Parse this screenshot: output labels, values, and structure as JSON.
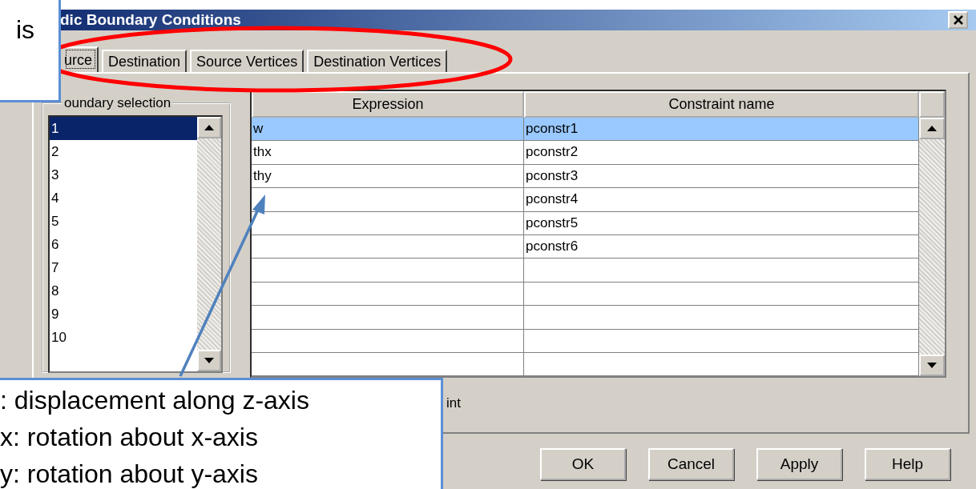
{
  "window": {
    "title": "dic Boundary Conditions"
  },
  "tabs": [
    {
      "label": "urce",
      "selected": true
    },
    {
      "label": "Destination",
      "selected": false
    },
    {
      "label": "Source Vertices",
      "selected": false
    },
    {
      "label": "Destination Vertices",
      "selected": false
    }
  ],
  "boundary_selection": {
    "label": "oundary selection",
    "items": [
      {
        "label": "1",
        "selected": true
      },
      {
        "label": "2",
        "selected": false
      },
      {
        "label": "3",
        "selected": false
      },
      {
        "label": "4",
        "selected": false
      },
      {
        "label": "5",
        "selected": false
      },
      {
        "label": "6",
        "selected": false
      },
      {
        "label": "7",
        "selected": false
      },
      {
        "label": "8",
        "selected": false
      },
      {
        "label": "9",
        "selected": false
      },
      {
        "label": "10",
        "selected": false
      }
    ]
  },
  "table": {
    "columns": [
      "Expression",
      "Constraint name"
    ],
    "rows": [
      {
        "expression": "w",
        "constraint_name": "pconstr1",
        "selected": true
      },
      {
        "expression": "thx",
        "constraint_name": "pconstr2",
        "selected": false
      },
      {
        "expression": "thy",
        "constraint_name": "pconstr3",
        "selected": false
      },
      {
        "constraint_name": "pconstr4",
        "selected": false
      },
      {
        "constraint_name": "pconstr5",
        "selected": false
      },
      {
        "constraint_name": "pconstr6",
        "selected": false
      },
      {
        "selected": false
      },
      {
        "selected": false
      },
      {
        "selected": false
      },
      {
        "selected": false
      },
      {
        "selected": false
      }
    ]
  },
  "checkbox_label": "int",
  "buttons": [
    "OK",
    "Cancel",
    "Apply",
    "Help"
  ],
  "callouts": [
    {
      "lines": [
        "is"
      ]
    },
    {
      "lines": [
        ": displacement along z-axis",
        "x: rotation about x-axis",
        "y: rotation about y-axis"
      ]
    }
  ]
}
